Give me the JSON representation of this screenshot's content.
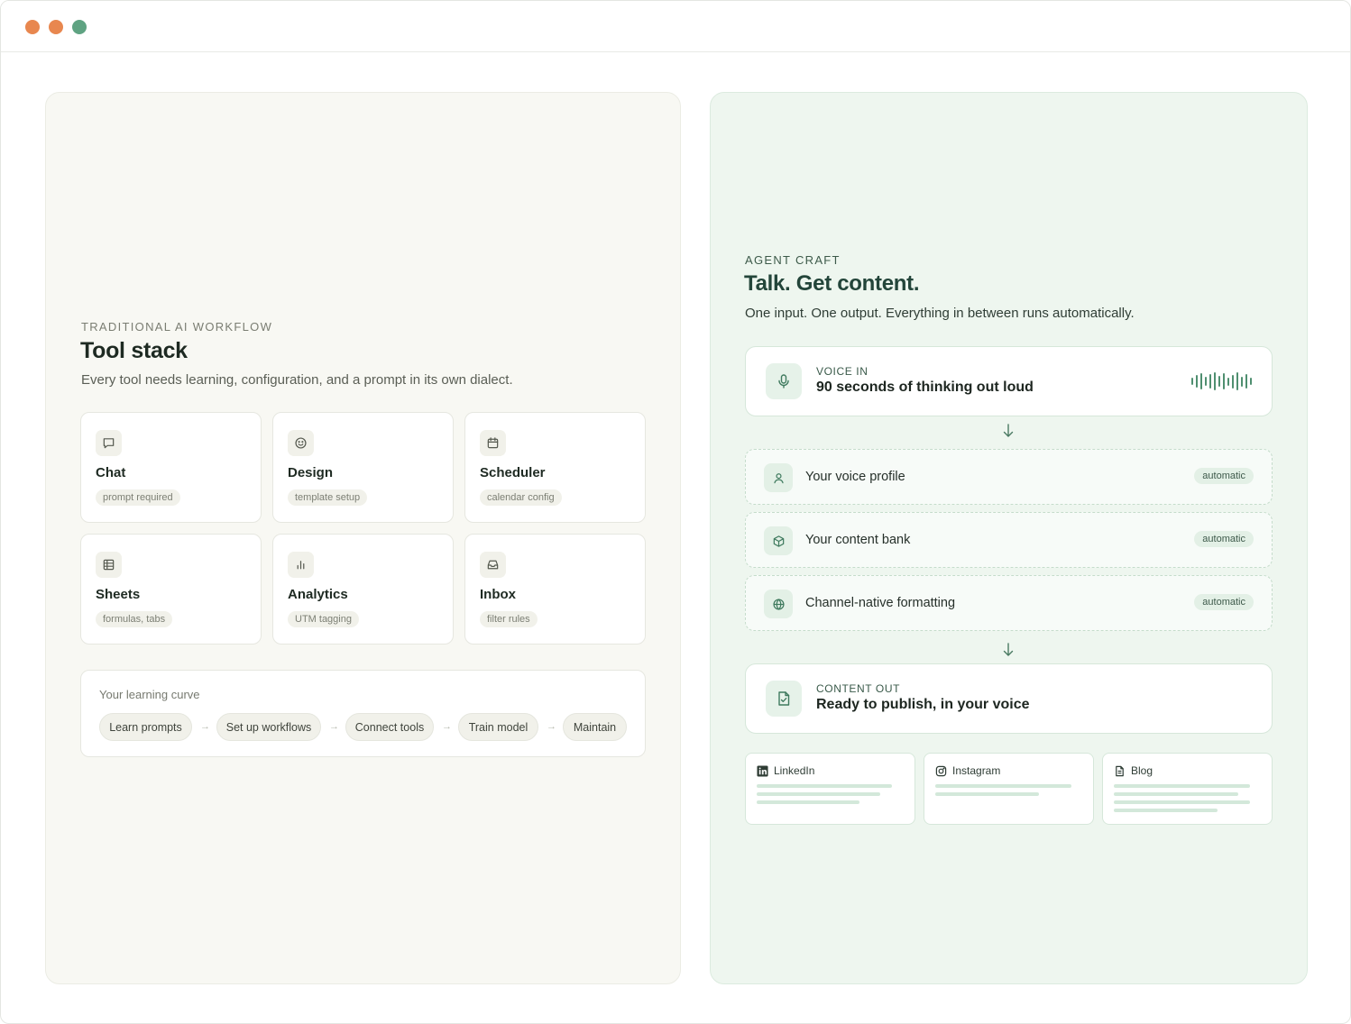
{
  "left": {
    "eyebrow": "TRADITIONAL AI WORKFLOW",
    "title": "Tool stack",
    "subtitle": "Every tool needs learning, configuration, and a prompt in its own dialect.",
    "tools": [
      {
        "name": "Chat",
        "tag": "prompt required",
        "icon": "chat-icon"
      },
      {
        "name": "Design",
        "tag": "template setup",
        "icon": "smile-icon"
      },
      {
        "name": "Scheduler",
        "tag": "calendar config",
        "icon": "calendar-icon"
      },
      {
        "name": "Sheets",
        "tag": "formulas, tabs",
        "icon": "table-icon"
      },
      {
        "name": "Analytics",
        "tag": "UTM tagging",
        "icon": "bar-chart-icon"
      },
      {
        "name": "Inbox",
        "tag": "filter rules",
        "icon": "inbox-icon"
      }
    ],
    "curve": {
      "title": "Your learning curve",
      "steps": [
        "Learn prompts",
        "Set up workflows",
        "Connect tools",
        "Train model",
        "Maintain"
      ],
      "arrow": "→"
    }
  },
  "right": {
    "eyebrow": "AGENT CRAFT",
    "title": "Talk. Get content.",
    "subtitle": "One input. One output. Everything in between runs automatically.",
    "voice_in": {
      "label": "VOICE IN",
      "value": "90 seconds of thinking out loud",
      "icon": "microphone-icon"
    },
    "steps": [
      {
        "label": "Your voice profile",
        "badge": "automatic",
        "icon": "user-icon"
      },
      {
        "label": "Your content bank",
        "badge": "automatic",
        "icon": "box-icon"
      },
      {
        "label": "Channel-native formatting",
        "badge": "automatic",
        "icon": "globe-icon"
      }
    ],
    "content_out": {
      "label": "CONTENT OUT",
      "value": "Ready to publish, in your voice",
      "icon": "document-check-icon"
    },
    "channels": [
      {
        "name": "LinkedIn",
        "icon": "linkedin-icon"
      },
      {
        "name": "Instagram",
        "icon": "instagram-icon"
      },
      {
        "name": "Blog",
        "icon": "document-icon"
      }
    ]
  },
  "colors": {
    "accent_green": "#4f8f70",
    "traffic_orange": "#e8874f",
    "traffic_green": "#5fa382",
    "left_panel_bg": "#f8f8f3",
    "right_panel_bg": "#eef6ef"
  }
}
